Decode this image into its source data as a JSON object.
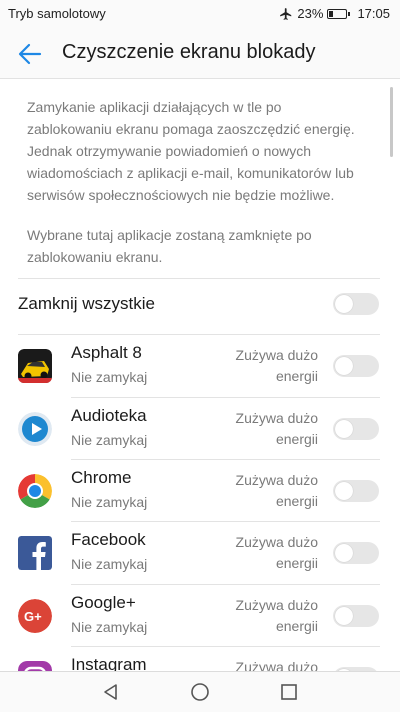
{
  "status_bar": {
    "airplane_mode_text": "Tryb samolotowy",
    "battery_percent": "23%",
    "time": "17:05",
    "battery_level": 0.23,
    "icons": [
      "airplane-icon",
      "battery-icon"
    ]
  },
  "app_bar": {
    "title": "Czyszczenie ekranu blokady",
    "back_icon": "arrow-left-icon",
    "accent_color": "#1e88e5"
  },
  "description": {
    "paragraph1": "Zamykanie aplikacji działających w tle po zablokowaniu ekranu pomaga zaoszczędzić energię. Jednak otrzymywanie powiadomień o nowych wiadomościach z aplikacji e-mail, komunikatorów lub serwisów społecznościowych nie będzie możliwe.",
    "paragraph2": "Wybrane tutaj aplikacje zostaną zamknięte po zablokowaniu ekranu."
  },
  "close_all": {
    "label": "Zamknij wszystkie",
    "enabled": false
  },
  "apps": [
    {
      "name": "Asphalt 8",
      "status": "Nie zamykaj",
      "energy_line1": "Zużywa dużo",
      "energy_line2": "energii",
      "icon": "asphalt-8-icon",
      "enabled": false
    },
    {
      "name": "Audioteka",
      "status": "Nie zamykaj",
      "energy_line1": "Zużywa dużo",
      "energy_line2": "energii",
      "icon": "audioteka-icon",
      "enabled": false
    },
    {
      "name": "Chrome",
      "status": "Nie zamykaj",
      "energy_line1": "Zużywa dużo",
      "energy_line2": "energii",
      "icon": "chrome-icon",
      "enabled": false
    },
    {
      "name": "Facebook",
      "status": "Nie zamykaj",
      "energy_line1": "Zużywa dużo",
      "energy_line2": "energii",
      "icon": "facebook-icon",
      "enabled": false
    },
    {
      "name": "Google+",
      "status": "Nie zamykaj",
      "energy_line1": "Zużywa dużo",
      "energy_line2": "energii",
      "icon": "google-plus-icon",
      "enabled": false
    },
    {
      "name": "Instagram",
      "status": "",
      "energy_line1": "Zużywa dużo",
      "energy_line2": "",
      "icon": "instagram-icon",
      "enabled": false
    }
  ],
  "nav_bar": {
    "icons": [
      "back-triangle-icon",
      "home-circle-icon",
      "recents-square-icon"
    ]
  }
}
